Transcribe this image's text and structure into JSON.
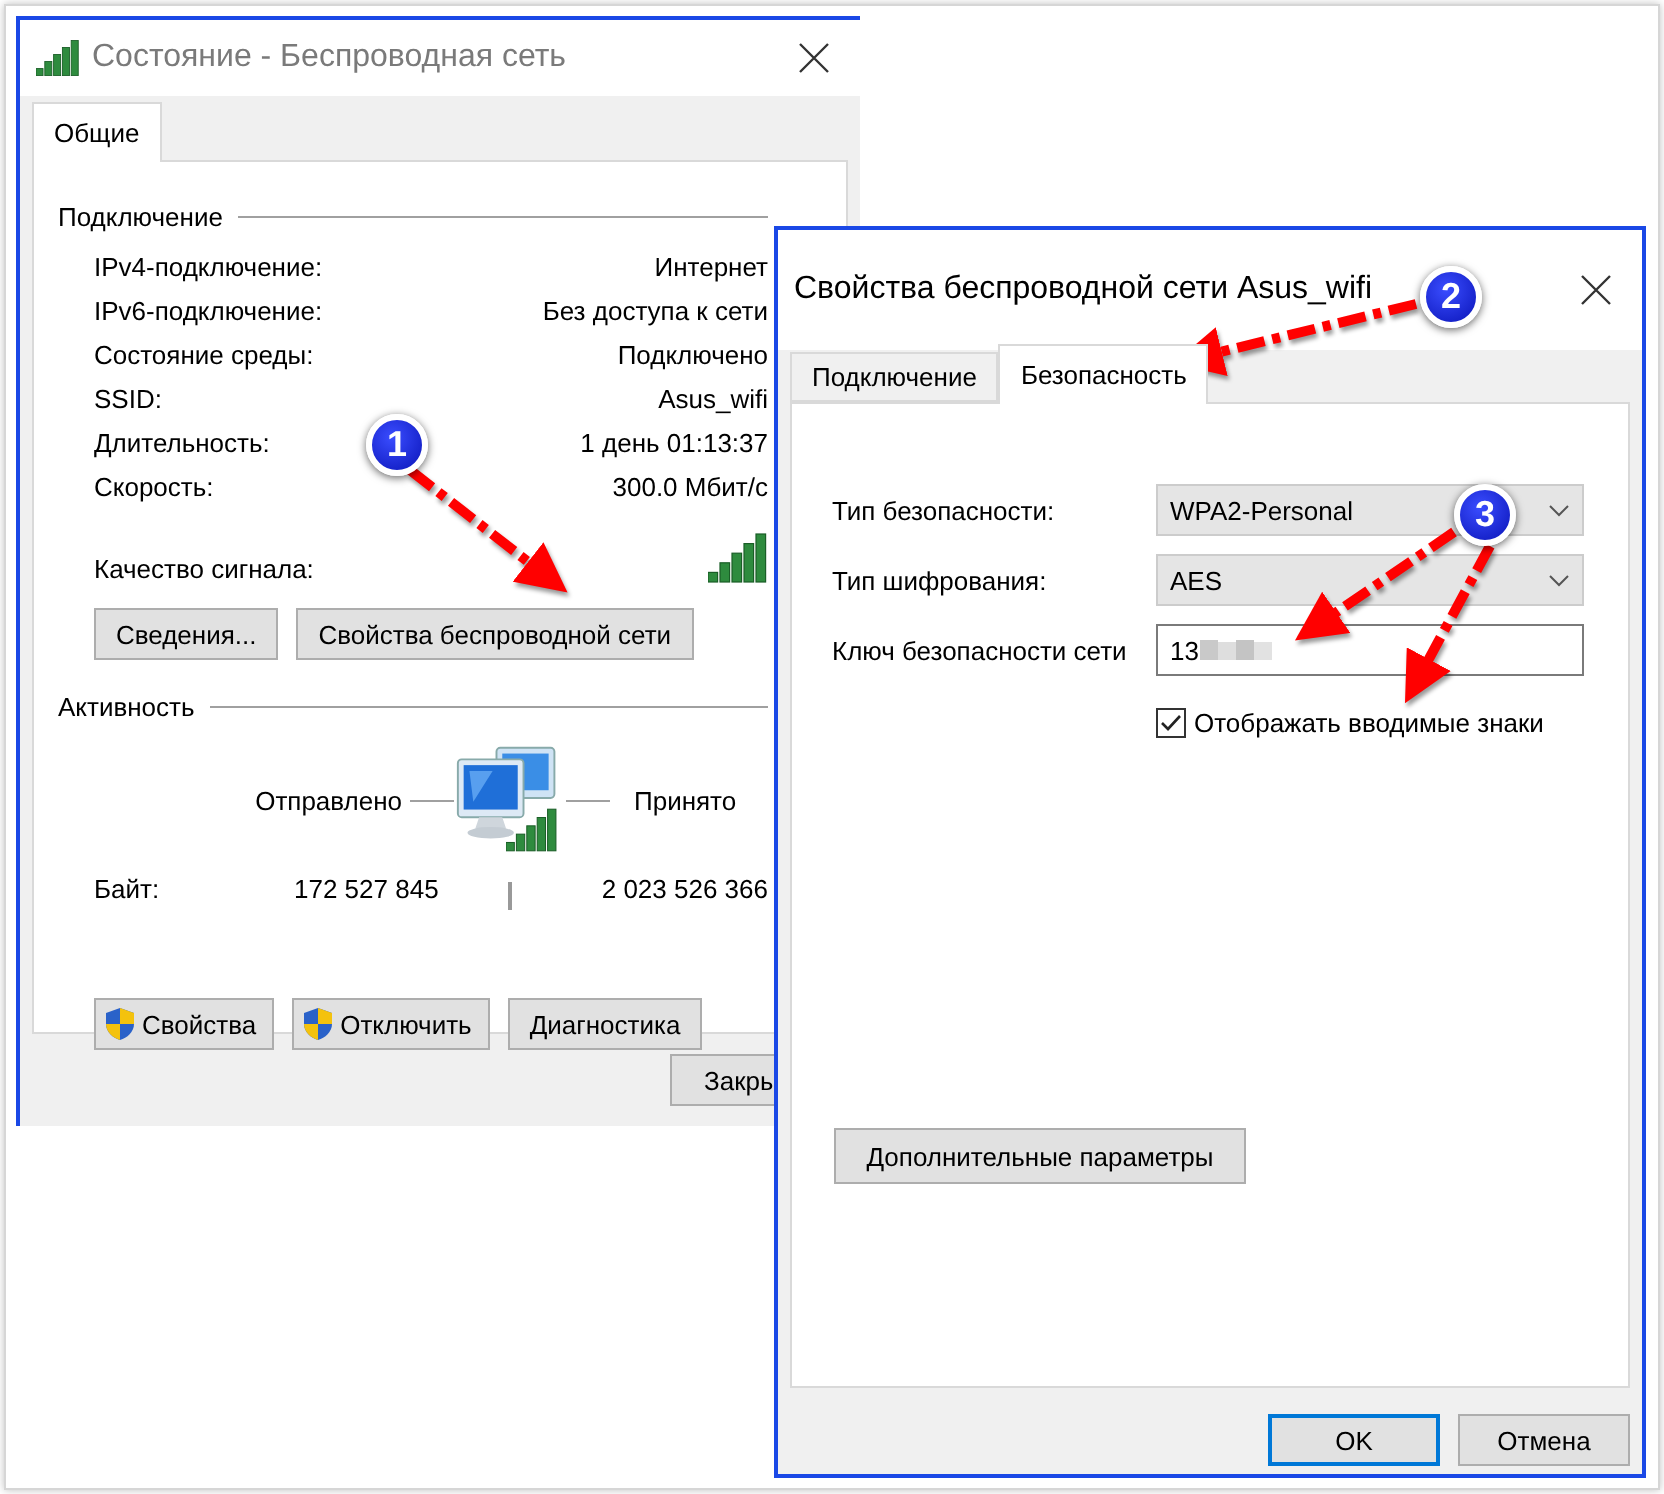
{
  "status_window": {
    "title": "Состояние - Беспроводная сеть",
    "tabs": [
      {
        "label": "Общие",
        "selected": true
      }
    ],
    "connection": {
      "heading": "Подключение",
      "rows": [
        {
          "label": "IPv4-подключение:",
          "value": "Интернет"
        },
        {
          "label": "IPv6-подключение:",
          "value": "Без доступа к сети"
        },
        {
          "label": "Состояние среды:",
          "value": "Подключено"
        },
        {
          "label": "SSID:",
          "value": "Asus_wifi"
        },
        {
          "label": "Длительность:",
          "value": "1 день 01:13:37"
        },
        {
          "label": "Скорость:",
          "value": "300.0 Мбит/с"
        }
      ],
      "signal_label": "Качество сигнала:"
    },
    "connection_buttons": [
      "Сведения...",
      "Свойства беспроводной сети"
    ],
    "activity": {
      "heading": "Активность",
      "sent_label": "Отправлено",
      "received_label": "Принято",
      "bytes_label": "Байт:",
      "sent": "172 527 845",
      "received": "2 023 526 366"
    },
    "action_buttons": [
      {
        "label": "Свойства",
        "shield": true
      },
      {
        "label": "Отключить",
        "shield": true
      },
      {
        "label": "Диагностика",
        "shield": false
      }
    ],
    "close_button": "Закры"
  },
  "properties_dialog": {
    "title": "Свойства беспроводной сети Asus_wifi",
    "tabs": [
      {
        "label": "Подключение",
        "selected": false
      },
      {
        "label": "Безопасность",
        "selected": true
      }
    ],
    "fields": [
      {
        "kind": "select",
        "label": "Тип безопасности:",
        "value": "WPA2-Personal"
      },
      {
        "kind": "select",
        "label": "Тип шифрования:",
        "value": "AES"
      },
      {
        "kind": "input",
        "label": "Ключ безопасности сети",
        "value": "13",
        "redacted": true
      }
    ],
    "show_characters": {
      "label": "Отображать вводимые знаки",
      "checked": true
    },
    "advanced_button": "Дополнительные параметры",
    "buttons": [
      {
        "label": "OK",
        "default": true
      },
      {
        "label": "Отмена",
        "default": false
      }
    ]
  },
  "annotations": [
    {
      "number": "1"
    },
    {
      "number": "2"
    },
    {
      "number": "3"
    }
  ]
}
